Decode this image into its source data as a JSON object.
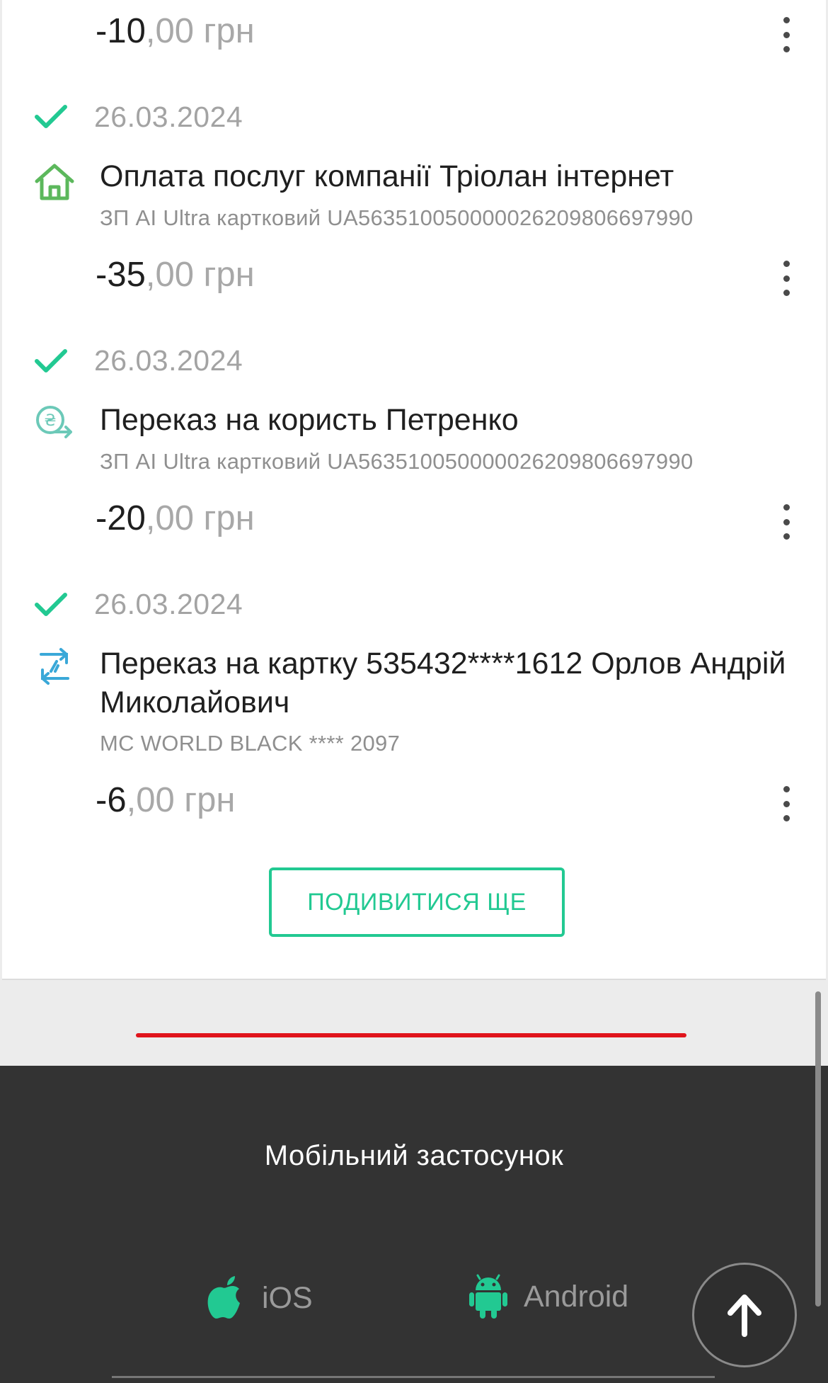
{
  "transactions": [
    {
      "amount_int": "-10",
      "amount_frac": ",00 грн"
    },
    {
      "date": "26.03.2024",
      "icon": "house-icon",
      "title": "Оплата послуг компанії Тріолан інтернет",
      "account": "ЗП AI Ultra картковий UA563510050000026209806697990",
      "amount_int": "-35",
      "amount_frac": ",00 грн"
    },
    {
      "date": "26.03.2024",
      "icon": "hryvnia-transfer-icon",
      "title": "Переказ на користь Петренко",
      "account": "ЗП AI Ultra картковий UA563510050000026209806697990",
      "amount_int": "-20",
      "amount_frac": ",00 грн"
    },
    {
      "date": "26.03.2024",
      "icon": "card-transfer-icon",
      "title": "Переказ на картку 535432****1612 Орлов Андрій Миколайович",
      "account": "MC WORLD BLACK **** 2097",
      "amount_int": "-6",
      "amount_frac": ",00 грн"
    }
  ],
  "more_button": "ПОДИВИТИСЯ ЩЕ",
  "footer": {
    "title": "Мобільний застосунок",
    "ios_label": "iOS",
    "android_label": "Android"
  },
  "colors": {
    "accent": "#22c992",
    "house_icon": "#5cb85c",
    "transfer_icon": "#6cc9b8",
    "card_icon": "#3aa8d8",
    "divider_red": "#e0141c",
    "footer_bg": "#333333"
  }
}
